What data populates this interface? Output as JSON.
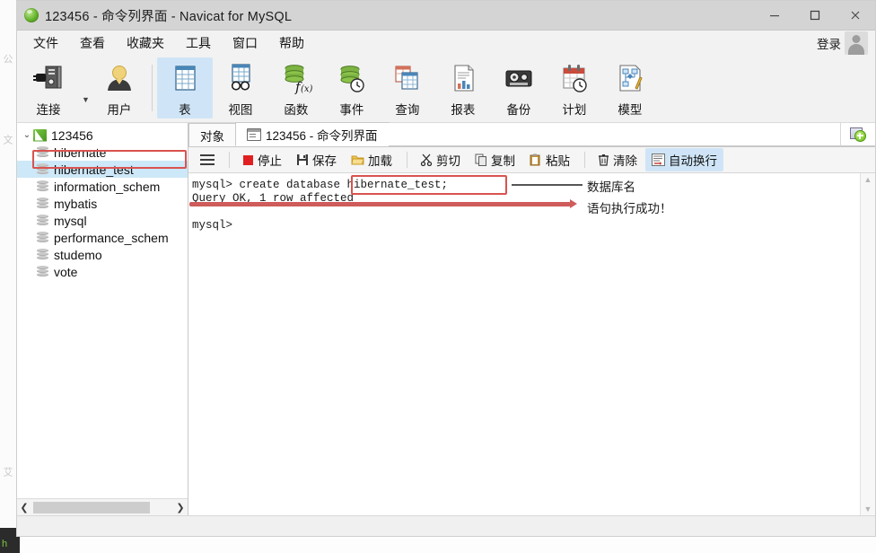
{
  "window": {
    "title": "123456 - 命令列界面 - Navicat for MySQL",
    "app_icon": "navicat-green-leaf-icon",
    "minimize_label": "–",
    "maximize_label": "□",
    "close_label": "✕"
  },
  "menubar": {
    "items": [
      {
        "label": "文件"
      },
      {
        "label": "查看"
      },
      {
        "label": "收藏夹"
      },
      {
        "label": "工具"
      },
      {
        "label": "窗口"
      },
      {
        "label": "帮助"
      }
    ],
    "login_label": "登录",
    "avatar_icon": "user-avatar-icon"
  },
  "toolbar": {
    "groups": [
      {
        "buttons": [
          {
            "label": "连接",
            "icon": "connection-plug-icon",
            "active": false,
            "has_caret": true
          },
          {
            "label": "用户",
            "icon": "user-icon",
            "active": false,
            "has_caret": false
          }
        ]
      },
      {
        "buttons": [
          {
            "label": "表",
            "icon": "table-grid-icon",
            "active": true,
            "has_caret": false
          },
          {
            "label": "视图",
            "icon": "view-glasses-icon",
            "active": false,
            "has_caret": false
          },
          {
            "label": "函数",
            "icon": "function-fx-icon",
            "active": false,
            "has_caret": false
          },
          {
            "label": "事件",
            "icon": "event-clock-icon",
            "active": false,
            "has_caret": false
          },
          {
            "label": "查询",
            "icon": "query-table-icon",
            "active": false,
            "has_caret": false
          },
          {
            "label": "报表",
            "icon": "report-chart-icon",
            "active": false,
            "has_caret": false
          },
          {
            "label": "备份",
            "icon": "backup-tape-icon",
            "active": false,
            "has_caret": false
          },
          {
            "label": "计划",
            "icon": "schedule-calendar-clock-icon",
            "active": false,
            "has_caret": false
          },
          {
            "label": "模型",
            "icon": "model-diagram-icon",
            "active": false,
            "has_caret": false
          }
        ]
      }
    ]
  },
  "sidebar": {
    "tree": [
      {
        "label": "123456",
        "icon": "connection-icon",
        "level": 0,
        "expanded": true,
        "selected": false
      },
      {
        "label": "hibernate",
        "icon": "database-icon",
        "level": 1,
        "selected": false
      },
      {
        "label": "hibernate_test",
        "icon": "database-icon",
        "level": 1,
        "selected": true
      },
      {
        "label": "information_schem",
        "icon": "database-icon",
        "level": 1,
        "selected": false
      },
      {
        "label": "mybatis",
        "icon": "database-icon",
        "level": 1,
        "selected": false
      },
      {
        "label": "mysql",
        "icon": "database-icon",
        "level": 1,
        "selected": false
      },
      {
        "label": "performance_schem",
        "icon": "database-icon",
        "level": 1,
        "selected": false
      },
      {
        "label": "studemo",
        "icon": "database-icon",
        "level": 1,
        "selected": false
      },
      {
        "label": "vote",
        "icon": "database-icon",
        "level": 1,
        "selected": false
      }
    ],
    "scroll_left_icon": "chevron-left-icon",
    "scroll_right_icon": "chevron-right-icon"
  },
  "tabs": {
    "items": [
      {
        "label": "对象",
        "icon": "",
        "active": false
      },
      {
        "label": "123456 - 命令列界面",
        "icon": "console-icon",
        "active": true
      }
    ],
    "add_tab_icon": "new-tab-plus-icon"
  },
  "console_actions": {
    "menu_icon": "hamburger-menu-icon",
    "buttons": [
      {
        "label": "停止",
        "icon": "stop-square-icon",
        "active": false
      },
      {
        "label": "保存",
        "icon": "save-disk-icon",
        "active": false
      },
      {
        "label": "加载",
        "icon": "load-folder-icon",
        "active": false
      },
      {
        "label": "剪切",
        "icon": "scissors-icon",
        "active": false
      },
      {
        "label": "复制",
        "icon": "copy-icon",
        "active": false
      },
      {
        "label": "粘贴",
        "icon": "paste-icon",
        "active": false
      },
      {
        "label": "清除",
        "icon": "trash-icon",
        "active": false
      },
      {
        "label": "自动换行",
        "icon": "word-wrap-icon",
        "active": true
      }
    ]
  },
  "console": {
    "lines": [
      "mysql> create database hibernate_test;",
      "Query OK, 1 row affected",
      "",
      "mysql>"
    ],
    "scroll_up_icon": "scroll-up-arrow-icon",
    "scroll_down_icon": "scroll-down-arrow-icon"
  },
  "annotations": [
    {
      "id": "db-name",
      "text": "数据库名"
    },
    {
      "id": "success",
      "text": "语句执行成功！"
    }
  ],
  "statusbar": {
    "text": ""
  },
  "colors": {
    "accent": "#cfe5f7",
    "annotation": "#d9534f",
    "arrow": "#cf5b5b",
    "selection": "#cde8f8"
  }
}
